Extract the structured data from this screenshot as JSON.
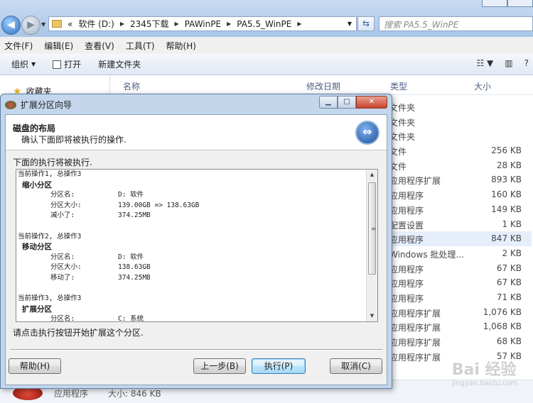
{
  "explorer": {
    "breadcrumbs": [
      "软件 (D:)",
      "2345下载",
      "PAWinPE",
      "PA5.5_WinPE"
    ],
    "prefix_chevron": "«",
    "search_placeholder": "搜索 PA5.5_WinPE",
    "menu": [
      "文件(F)",
      "编辑(E)",
      "查看(V)",
      "工具(T)",
      "帮助(H)"
    ],
    "toolbar": {
      "organize": "组织",
      "open": "打开",
      "new_folder": "新建文件夹"
    },
    "sidebar": {
      "favorites": "收藏夹"
    },
    "columns": {
      "name": "名称",
      "modified": "修改日期",
      "type": "类型",
      "size": "大小"
    },
    "files": [
      {
        "type": "文件夹",
        "size": ""
      },
      {
        "type": "文件夹",
        "size": ""
      },
      {
        "type": "文件夹",
        "size": ""
      },
      {
        "type": "文件",
        "size": "256 KB"
      },
      {
        "type": "文件",
        "size": "28 KB"
      },
      {
        "type": "应用程序扩展",
        "size": "893 KB"
      },
      {
        "type": "应用程序",
        "size": "160 KB"
      },
      {
        "type": "应用程序",
        "size": "149 KB"
      },
      {
        "type": "配置设置",
        "size": "1 KB"
      },
      {
        "type": "应用程序",
        "size": "847 KB"
      },
      {
        "type": "Windows 批处理...",
        "size": "2 KB"
      },
      {
        "type": "应用程序",
        "size": "67 KB"
      },
      {
        "type": "应用程序",
        "size": "67 KB"
      },
      {
        "type": "应用程序",
        "size": "71 KB"
      },
      {
        "type": "应用程序扩展",
        "size": "1,076 KB"
      },
      {
        "type": "应用程序扩展",
        "size": "1,068 KB"
      },
      {
        "type": "应用程序扩展",
        "size": "68 KB"
      },
      {
        "type": "应用程序扩展",
        "size": "57 KB"
      }
    ],
    "status": {
      "type": "应用程序",
      "size": "大小: 846 KB"
    },
    "watermark": {
      "main": "Bai 经验",
      "sub": "jingyan.baidu.com"
    }
  },
  "dialog": {
    "title": "扩展分区向导",
    "heading": "磁盘的布局",
    "subheading": "确认下面即将被执行的操作.",
    "lead": "下面的执行将被执行.",
    "operations": [
      {
        "header": "当前操作1, 总操作3",
        "name": "缩小分区",
        "rows": [
          {
            "k": "分区名:",
            "v": "D: 软件"
          },
          {
            "k": "分区大小:",
            "v": "139.00GB => 138.63GB"
          },
          {
            "k": "减小了:",
            "v": "374.25MB"
          }
        ]
      },
      {
        "header": "当前操作2, 总操作3",
        "name": "移动分区",
        "rows": [
          {
            "k": "分区名:",
            "v": "D: 软件"
          },
          {
            "k": "分区大小:",
            "v": "138.63GB"
          },
          {
            "k": "移动了:",
            "v": "374.25MB"
          }
        ]
      },
      {
        "header": "当前操作3, 总操作3",
        "name": "扩展分区",
        "rows": [
          {
            "k": "分区名:",
            "v": "C: 系统"
          }
        ]
      }
    ],
    "note": "请点击执行按钮开始扩展这个分区.",
    "buttons": {
      "help": "帮助(H)",
      "back": "上一步(B)",
      "execute": "执行(P)",
      "cancel": "取消(C)"
    }
  }
}
